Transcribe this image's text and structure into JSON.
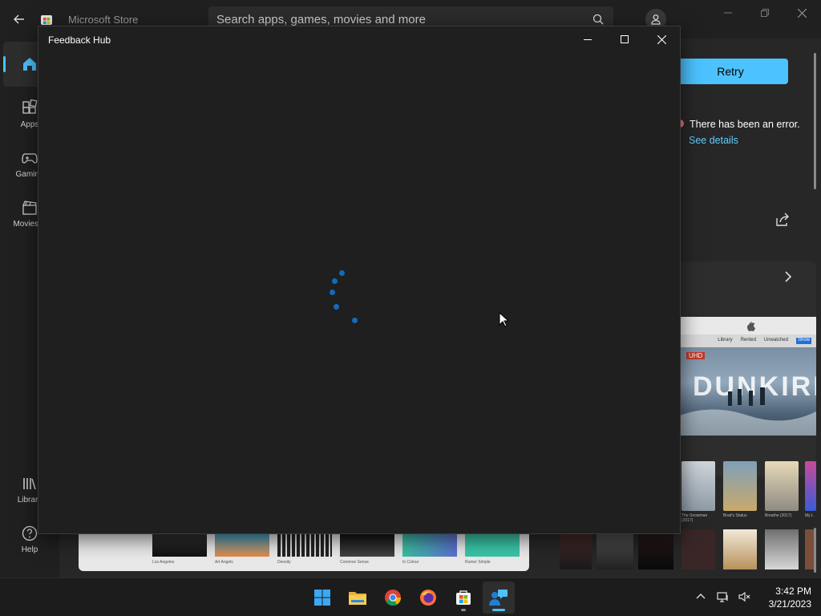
{
  "store": {
    "title": "Microsoft Store",
    "search_placeholder": "Search apps, games, movies and more",
    "nav": {
      "home": "Home",
      "apps": "Apps",
      "gaming": "Gaming",
      "movies": "Movies &",
      "library": "Library",
      "help": "Help"
    },
    "retry_label": "Retry",
    "error_text": "There has been an error.",
    "see_details": "See details",
    "apple_tabs": [
      "Library",
      "Rented",
      "Unwatched",
      "Show"
    ],
    "featured_title": "DUNKIRK",
    "featured_tag": "UHD",
    "poster_captions": [
      "The Snowman (2017)",
      "Brad's Status",
      "Breathe (2017)",
      "My L"
    ],
    "strip_captions": [
      "Los Angeles",
      "Art Angels",
      "Density",
      "Common Sense",
      "In Colour",
      "Rumor Simple"
    ],
    "accent": "#4cc2ff"
  },
  "feedback_hub": {
    "title": "Feedback Hub",
    "spinner_color": "#0f6cbd"
  },
  "taskbar": {
    "apps": [
      "start-icon",
      "file-explorer-icon",
      "chrome-icon",
      "firefox-icon",
      "microsoft-store-icon",
      "feedback-hub-icon"
    ],
    "time": "3:42 PM",
    "date": "3/21/2023"
  }
}
